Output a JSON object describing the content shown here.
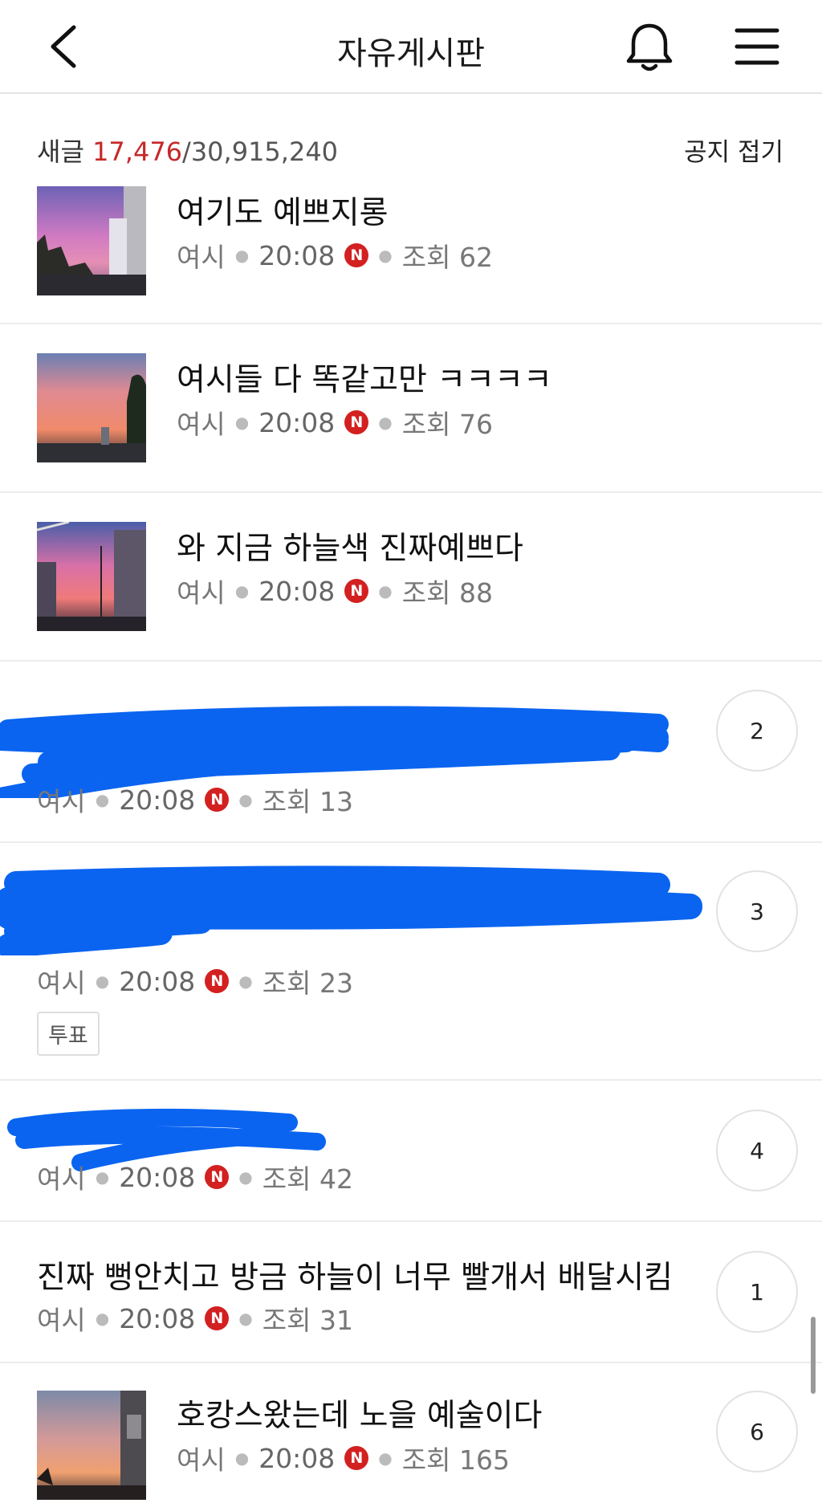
{
  "header": {
    "title": "자유게시판"
  },
  "stats": {
    "prefix": "새글",
    "new_count": "17,476",
    "total_count": "/30,915,240",
    "notice_toggle": "공지 접기"
  },
  "posts": [
    {
      "title": "여기도 예쁘지롱",
      "author": "여시",
      "time": "20:08",
      "new": "N",
      "views": "조회 62",
      "has_thumb": true
    },
    {
      "title": "여시들 다 똑같고만 ㅋㅋㅋㅋ",
      "author": "여시",
      "time": "20:08",
      "new": "N",
      "views": "조회 76",
      "has_thumb": true
    },
    {
      "title": "와 지금 하늘색 진짜예쁘다",
      "author": "여시",
      "time": "20:08",
      "new": "N",
      "views": "조회 88",
      "has_thumb": true
    },
    {
      "title": "",
      "author": "여시",
      "time": "20:08",
      "new": "N",
      "views": "조회 13",
      "comments": "2",
      "redacted": true
    },
    {
      "title": "",
      "author": "여시",
      "time": "20:08",
      "new": "N",
      "views": "조회 23",
      "comments": "3",
      "redacted": true,
      "tag": "투표"
    },
    {
      "title": "",
      "author": "여시",
      "time": "20:08",
      "new": "N",
      "views": "조회 42",
      "comments": "4",
      "redacted": true
    },
    {
      "title": "진짜 뻥안치고 방금 하늘이 너무 빨개서 배달시킴",
      "author": "여시",
      "time": "20:08",
      "new": "N",
      "views": "조회 31",
      "comments": "1"
    },
    {
      "title": "호캉스왔는데 노을 예술이다",
      "author": "여시",
      "time": "20:08",
      "new": "N",
      "views": "조회 165",
      "comments": "6",
      "has_thumb": true
    }
  ],
  "icons": {
    "back": "chevron-left-icon",
    "bell": "bell-icon",
    "menu": "hamburger-menu-icon"
  },
  "colors": {
    "accent_red": "#c62828",
    "new_badge": "#d32020",
    "redaction_blue": "#0a64f0"
  }
}
